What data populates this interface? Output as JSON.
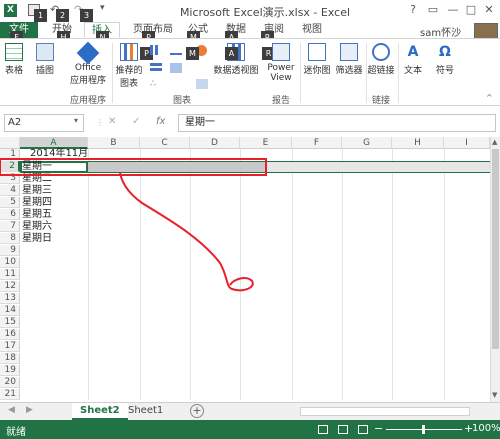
{
  "window": {
    "title": "Microsoft Excel演示.xlsx - Excel",
    "user": "sam怀沙",
    "help": "?"
  },
  "qat": {
    "keytips": [
      "1",
      "2",
      "3"
    ]
  },
  "tabs": [
    {
      "label": "文件",
      "keytip": "F"
    },
    {
      "label": "开始",
      "keytip": "H"
    },
    {
      "label": "插入",
      "keytip": "N"
    },
    {
      "label": "页面布局",
      "keytip": "P"
    },
    {
      "label": "公式",
      "keytip": "M"
    },
    {
      "label": "数据",
      "keytip": "A"
    },
    {
      "label": "审阅",
      "keytip": "R"
    },
    {
      "label": "视图",
      "keytip": ""
    }
  ],
  "ribbon": {
    "table": "表格",
    "illustration": "插图",
    "office_app_line1": "Office",
    "office_app_line2": "应用程序",
    "rec_chart_line1": "推荐的",
    "rec_chart_line2": "图表",
    "pivot_chart": "数据透视图",
    "power_view_line1": "Power",
    "power_view_line2": "View",
    "sparkline": "迷你图",
    "filter": "筛选器",
    "hyperlink": "超链接",
    "text": "文本",
    "symbol": "符号",
    "group_apps": "应用程序",
    "group_charts": "图表",
    "group_reports": "报告",
    "group_links": "链接"
  },
  "formula_bar": {
    "name_box": "A2",
    "cancel": "✕",
    "enter": "✓",
    "fx": "fx",
    "value": "星期一"
  },
  "columns": [
    "A",
    "B",
    "C",
    "D",
    "E",
    "F",
    "G",
    "H",
    "I"
  ],
  "rows": [
    "1",
    "2",
    "3",
    "4",
    "5",
    "6",
    "7",
    "8",
    "9",
    "10",
    "11",
    "12",
    "13",
    "14",
    "15",
    "16",
    "17",
    "18",
    "19",
    "20",
    "21"
  ],
  "cells": {
    "a1": "2014年11月",
    "a2": "星期一",
    "a3": "星期二",
    "a4": "星期三",
    "a5": "星期四",
    "a6": "星期五",
    "a7": "星期六",
    "a8": "星期日"
  },
  "sheets": [
    "Sheet2",
    "Sheet1"
  ],
  "status": {
    "ready": "就绪",
    "zoom": "100%"
  },
  "colors": {
    "excel_green": "#217346",
    "annotation_red": "#e8202a"
  }
}
